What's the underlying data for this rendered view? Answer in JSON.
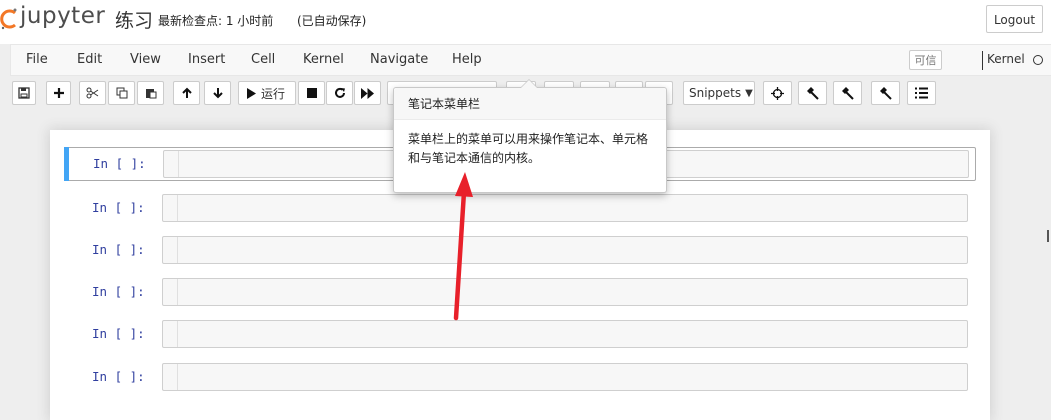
{
  "header": {
    "logo_text": "jupyter",
    "notebook_name": "练习",
    "checkpoint": "最新检查点: 1 小时前",
    "autosave_status": "(已自动保存)",
    "logout_label": "Logout"
  },
  "menubar": {
    "items": [
      "File",
      "Edit",
      "View",
      "Insert",
      "Cell",
      "Kernel",
      "Navigate",
      "Help"
    ],
    "trusted_label": "可信",
    "kernel_label": "Kernel"
  },
  "toolbar": {
    "run_label": "运行",
    "snippets_label": "Snippets",
    "buttons": [
      "save-icon",
      "plus-icon",
      "scissors-icon",
      "copy-icon",
      "paste-icon",
      "arrow-up-icon",
      "arrow-down-icon",
      "play-icon",
      "stop-icon",
      "restart-icon",
      "fast-forward-icon",
      "crosshair-icon",
      "hammer-icon",
      "hammer-icon",
      "hammer-icon",
      "list-icon"
    ]
  },
  "cells": [
    {
      "prompt": "In  [ ]:"
    },
    {
      "prompt": "In  [ ]:"
    },
    {
      "prompt": "In  [ ]:"
    },
    {
      "prompt": "In  [ ]:"
    },
    {
      "prompt": "In  [ ]:"
    },
    {
      "prompt": "In  [ ]:"
    }
  ],
  "tooltip": {
    "title": "笔记本菜单栏",
    "body": "菜单栏上的菜单可以用来操作笔记本、单元格和与笔记本通信的内核。"
  },
  "colors": {
    "selected_cell_bar": "#42a5f5",
    "annotation_arrow": "#e8202a",
    "prompt": "#303f9f"
  }
}
